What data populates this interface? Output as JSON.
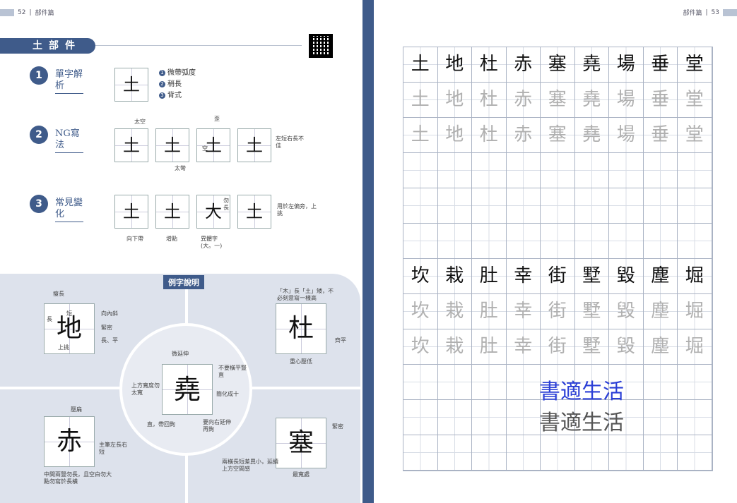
{
  "left_header": {
    "page": "52",
    "section": "部件篇"
  },
  "right_header": {
    "page": "53",
    "section": "部件篇"
  },
  "banner": "土部件",
  "sections": [
    {
      "num": "1",
      "title": "單字解析"
    },
    {
      "num": "2",
      "title": "NG寫法"
    },
    {
      "num": "3",
      "title": "常見變化"
    }
  ],
  "analysis": {
    "char": "土",
    "bullets": [
      "微帶弧度",
      "稍長",
      "背式"
    ],
    "bullet_nums": [
      "1",
      "2",
      "3"
    ]
  },
  "ng": {
    "chars": [
      "土",
      "土",
      "土",
      "土"
    ],
    "notes": [
      "太空",
      "太彎",
      "歪",
      "空",
      "左短右長不佳"
    ]
  },
  "variations": {
    "chars": [
      "土",
      "土",
      "大",
      "土"
    ],
    "notes": [
      "向下帶",
      "增點",
      "異體字(大。一)",
      "勿長",
      "用於左偏旁，上挑"
    ]
  },
  "examples_tag": "例字說明",
  "examples": [
    {
      "char": "地",
      "notes": [
        "瘦長",
        "短",
        "長",
        "向內斜",
        "緊密",
        "長、平",
        "上挑"
      ]
    },
    {
      "char": "杜",
      "notes": [
        "「木」長「土」矮，不必刻意寫一樣高",
        "齊平",
        "重心壓低"
      ]
    },
    {
      "char": "堯",
      "notes": [
        "微延伸",
        "不要橫平豎直",
        "上方寬度勿太寬",
        "簡化成十",
        "直，帶回鉤",
        "要向右延伸再鉤"
      ]
    },
    {
      "char": "赤",
      "notes": [
        "壓扁",
        "主筆左長右短",
        "中間兩豎勿長，且空白勿大",
        "點勿寫於長橫"
      ]
    },
    {
      "char": "塞",
      "notes": [
        "緊密",
        "兩橫長短差異小，延續上方空間感",
        "最寬處"
      ]
    }
  ],
  "practice": {
    "row1": [
      "土",
      "地",
      "杜",
      "赤",
      "塞",
      "堯",
      "場",
      "垂",
      "堂"
    ],
    "row2": [
      "坎",
      "栽",
      "肚",
      "幸",
      "街",
      "墅",
      "毀",
      "塵",
      "堀"
    ]
  },
  "watermark": "書適生活"
}
